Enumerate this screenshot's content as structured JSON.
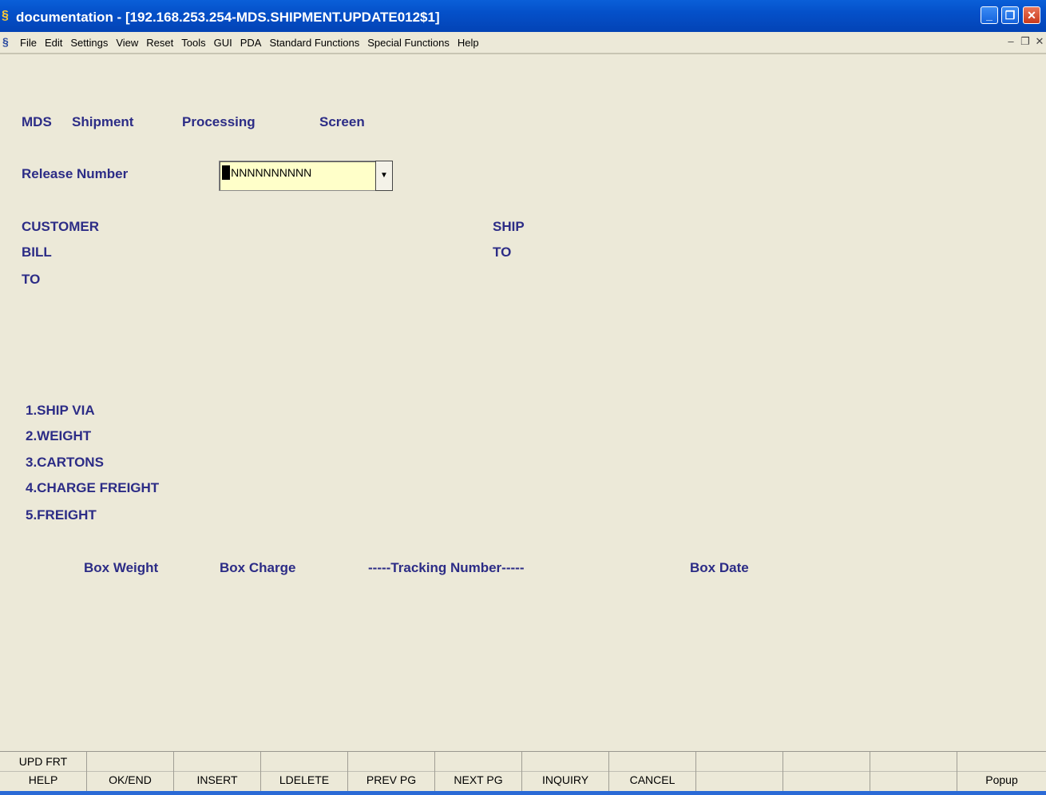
{
  "window": {
    "title": "documentation - [192.168.253.254-MDS.SHIPMENT.UPDATE012$1]",
    "app_icon": "sh-logo-icon",
    "controls": {
      "minimize": "_",
      "restore": "❐",
      "close": "✕"
    }
  },
  "menubar": {
    "items": [
      "File",
      "Edit",
      "Settings",
      "View",
      "Reset",
      "Tools",
      "GUI",
      "PDA",
      "Standard Functions",
      "Special Functions",
      "Help"
    ],
    "mdi_controls": {
      "minimize": "–",
      "restore": "❐",
      "close": "✕"
    }
  },
  "screen": {
    "title_words": [
      "MDS",
      "Shipment",
      "Processing",
      "Screen"
    ],
    "release_label": "Release Number",
    "release_value": "NNNNNNNNNNN",
    "customer_bill_to": [
      "CUSTOMER",
      "BILL",
      "TO"
    ],
    "ship_to": [
      "SHIP",
      "TO"
    ],
    "options": [
      "1.SHIP VIA",
      "2.WEIGHT",
      "3.CARTONS",
      "4.CHARGE FREIGHT",
      "5.FREIGHT"
    ],
    "box_headers": {
      "weight": "Box Weight",
      "charge": "Box Charge",
      "tracking": "-----Tracking Number-----",
      "date": "Box Date"
    }
  },
  "function_keys": [
    {
      "top": "UPD FRT",
      "bottom": "HELP"
    },
    {
      "top": "",
      "bottom": "OK/END"
    },
    {
      "top": "",
      "bottom": "INSERT"
    },
    {
      "top": "",
      "bottom": "LDELETE"
    },
    {
      "top": "",
      "bottom": "PREV PG"
    },
    {
      "top": "",
      "bottom": "NEXT PG"
    },
    {
      "top": "",
      "bottom": "INQUIRY"
    },
    {
      "top": "",
      "bottom": "CANCEL"
    },
    {
      "top": "",
      "bottom": ""
    },
    {
      "top": "",
      "bottom": ""
    },
    {
      "top": "",
      "bottom": ""
    },
    {
      "top": "",
      "bottom": "Popup"
    }
  ]
}
